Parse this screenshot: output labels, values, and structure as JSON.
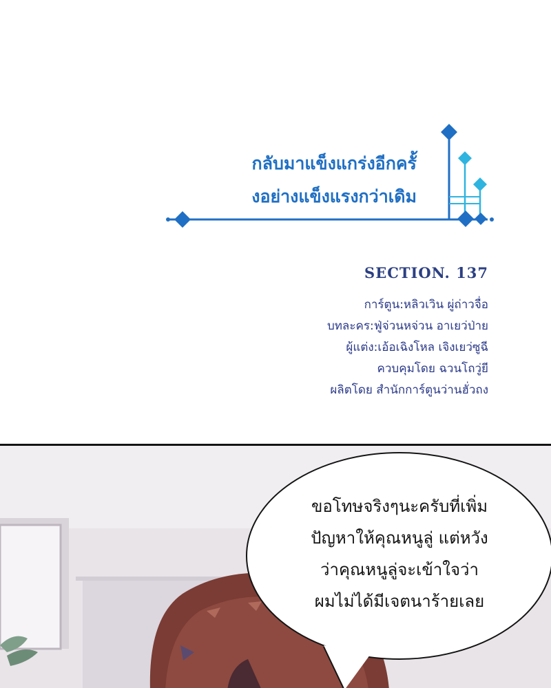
{
  "title": {
    "line1": "กลับมาแข็งแกร่งอีกครั้",
    "line2": "งอย่างแข็งแรงกว่าเดิม",
    "color": "#1f6fc4",
    "accent_color": "#2fb4e0"
  },
  "section": {
    "label": "SECTION. 137",
    "color": "#2b3f82"
  },
  "credits": [
    "การ์ตูน:หลิวเวิน ผู่ถ่าวจื่อ",
    "บทละคร:ฟู่จ่วนหจ่วน อาเยว่ป่าย",
    "ผู้แต่ง:เอ้อเฉิงโหล เจิงเยว่ซูฉี",
    "ควบคุมโดย ฉวนโถวู่ยี",
    "ผลิตโดย สำนักการ์ตูนว่านฮั่วถง"
  ],
  "speech_bubble": {
    "lines": [
      "ขอโทษจริงๆนะครับที่เพิ่ม",
      "ปัญหาให้คุณหนูลู่ แต่หวัง",
      "ว่าคุณหนูลู่จะเข้าใจว่า",
      "ผมไม่ได้มีเจตนาร้ายเลย"
    ]
  }
}
